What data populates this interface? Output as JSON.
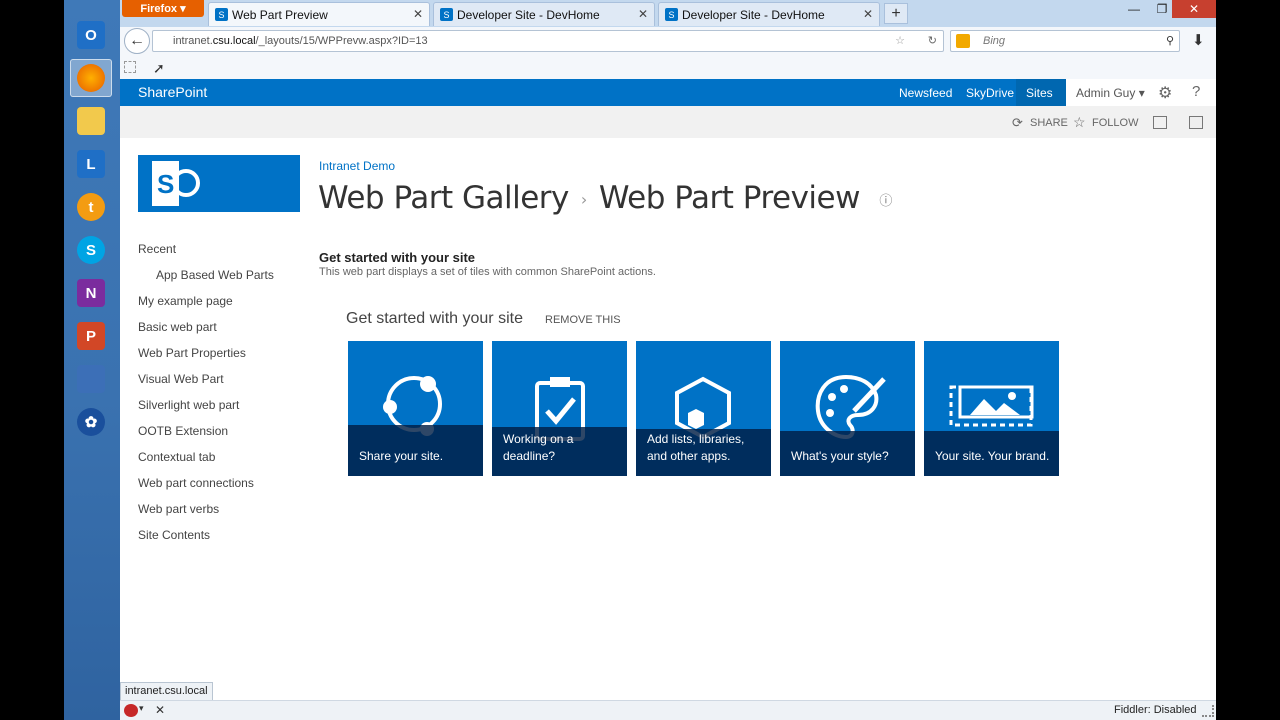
{
  "browser": {
    "ff_menu": "Firefox",
    "tabs": [
      {
        "label": "Web Part Preview"
      },
      {
        "label": "Developer Site - DevHome"
      },
      {
        "label": "Developer Site - DevHome"
      }
    ],
    "url_prefix": "intranet.",
    "url_domain": "csu.local",
    "url_path": "/_layouts/15/WPPrevw.aspx?ID=13",
    "search_placeholder": "Bing",
    "hover_url": "intranet.csu.local",
    "status_right": "Fiddler: Disabled"
  },
  "suitebar": {
    "brand": "SharePoint",
    "links": [
      "Newsfeed",
      "SkyDrive",
      "Sites"
    ],
    "user": "Admin Guy"
  },
  "ribbon": {
    "share": "SHARE",
    "follow": "FOLLOW"
  },
  "page": {
    "breadcrumb": "Intranet Demo",
    "title_part1": "Web Part Gallery",
    "title_part2": "Web Part Preview"
  },
  "leftnav": [
    "Recent",
    "App Based Web Parts",
    "My example page",
    "Basic web part",
    "Web Part Properties",
    "Visual Web Part",
    "Silverlight web part",
    "OOTB Extension",
    "Contextual tab",
    "Web part connections",
    "Web part verbs",
    "Site Contents"
  ],
  "webpart": {
    "title": "Get started with your site",
    "description": "This web part displays a set of tiles with common SharePoint actions.",
    "heading": "Get started with your site",
    "remove": "REMOVE THIS",
    "tiles": [
      {
        "label": "Share your site.",
        "icon": "share-icon"
      },
      {
        "label": "Working on a deadline?",
        "icon": "clipboard-check-icon"
      },
      {
        "label": "Add lists, libraries, and other apps.",
        "icon": "hexagon-apps-icon"
      },
      {
        "label": "What's your style?",
        "icon": "palette-icon"
      },
      {
        "label": "Your site. Your brand.",
        "icon": "brand-image-icon"
      }
    ]
  },
  "colors": {
    "sharepoint_blue": "#0072c6",
    "taskbar": "#3a72b0",
    "firefox_orange": "#e66000"
  }
}
